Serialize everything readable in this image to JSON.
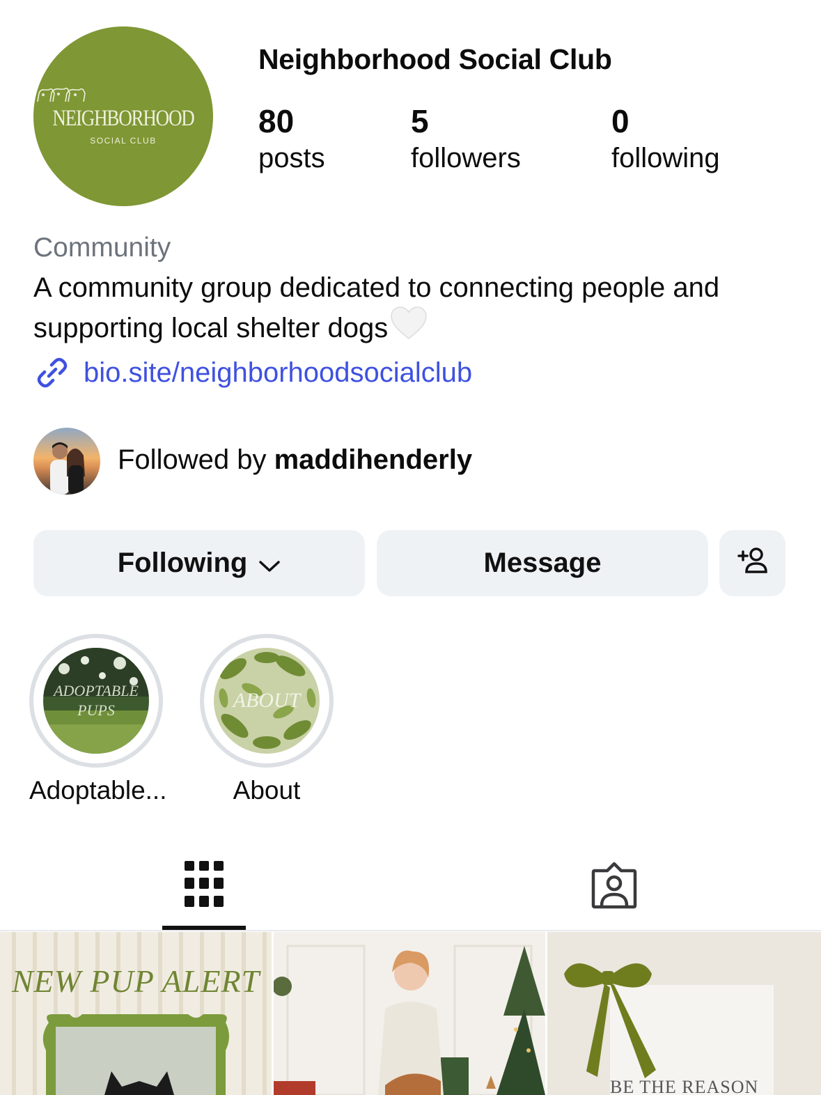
{
  "profile": {
    "avatar_word": "NEIGHBORHOOD",
    "avatar_sub": "SOCIAL CLUB",
    "display_name": "Neighborhood Social Club",
    "stats": [
      {
        "value": "80",
        "label": "posts"
      },
      {
        "value": "5",
        "label": "followers"
      },
      {
        "value": "0",
        "label": "following"
      }
    ],
    "category": "Community",
    "bio": "A community group dedicated to connecting people and supporting local shelter dogs",
    "link": "bio.site/neighborhoodsocialclub",
    "followed_by_prefix": "Followed by ",
    "followed_by_user": "maddihenderly"
  },
  "actions": {
    "following_label": "Following",
    "message_label": "Message",
    "add_user_icon": "add-person-icon"
  },
  "highlights": [
    {
      "label": "Adoptable...",
      "overlay": [
        "ADOPTABLE",
        "PUPS"
      ]
    },
    {
      "label": "About",
      "overlay": [
        "ABOUT"
      ]
    }
  ],
  "tabs": {
    "grid_icon": "grid-icon",
    "tagged_icon": "tagged-person-icon"
  },
  "posts": [
    {
      "title": "NEW PUP ALERT"
    },
    {
      "title": ""
    },
    {
      "caption": "BE THE REASON"
    }
  ],
  "colors": {
    "brand_green": "#7f9734",
    "link_blue": "#3f51e0",
    "button_bg": "#eff2f5",
    "muted_text": "#6d737c"
  }
}
